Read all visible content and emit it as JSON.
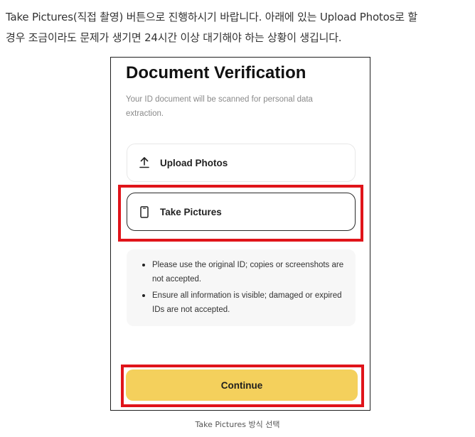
{
  "intro": {
    "line1": "Take Pictures(직접 촬영) 버튼으로 진행하시기 바랍니다. 아래에 있는 Upload Photos로 할",
    "line2": "경우 조금이라도 문제가 생기면 24시간 이상 대기해야 하는 상황이 생깁니다."
  },
  "screen": {
    "title": "Document Verification",
    "subtitle": "Your ID document will be scanned for personal data extraction.",
    "options": [
      {
        "label": "Upload Photos",
        "icon": "upload-icon"
      },
      {
        "label": "Take Pictures",
        "icon": "phone-icon",
        "highlighted": true
      }
    ],
    "notes": [
      "Please use the original ID; copies or screenshots are not accepted.",
      "Ensure all information is visible; damaged or expired IDs are not accepted."
    ],
    "continue_label": "Continue",
    "highlight_color": "#e0141a",
    "button_color": "#f4d05c"
  },
  "caption": "Take Pictures 방식 선택"
}
